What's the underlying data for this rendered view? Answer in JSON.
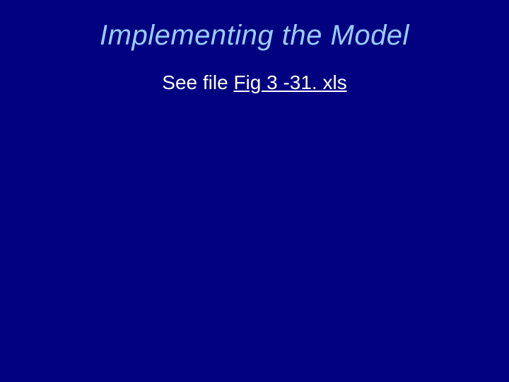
{
  "slide": {
    "title": "Implementing the Model",
    "body_prefix": "See file ",
    "file_link": "Fig 3 -31. xls"
  }
}
